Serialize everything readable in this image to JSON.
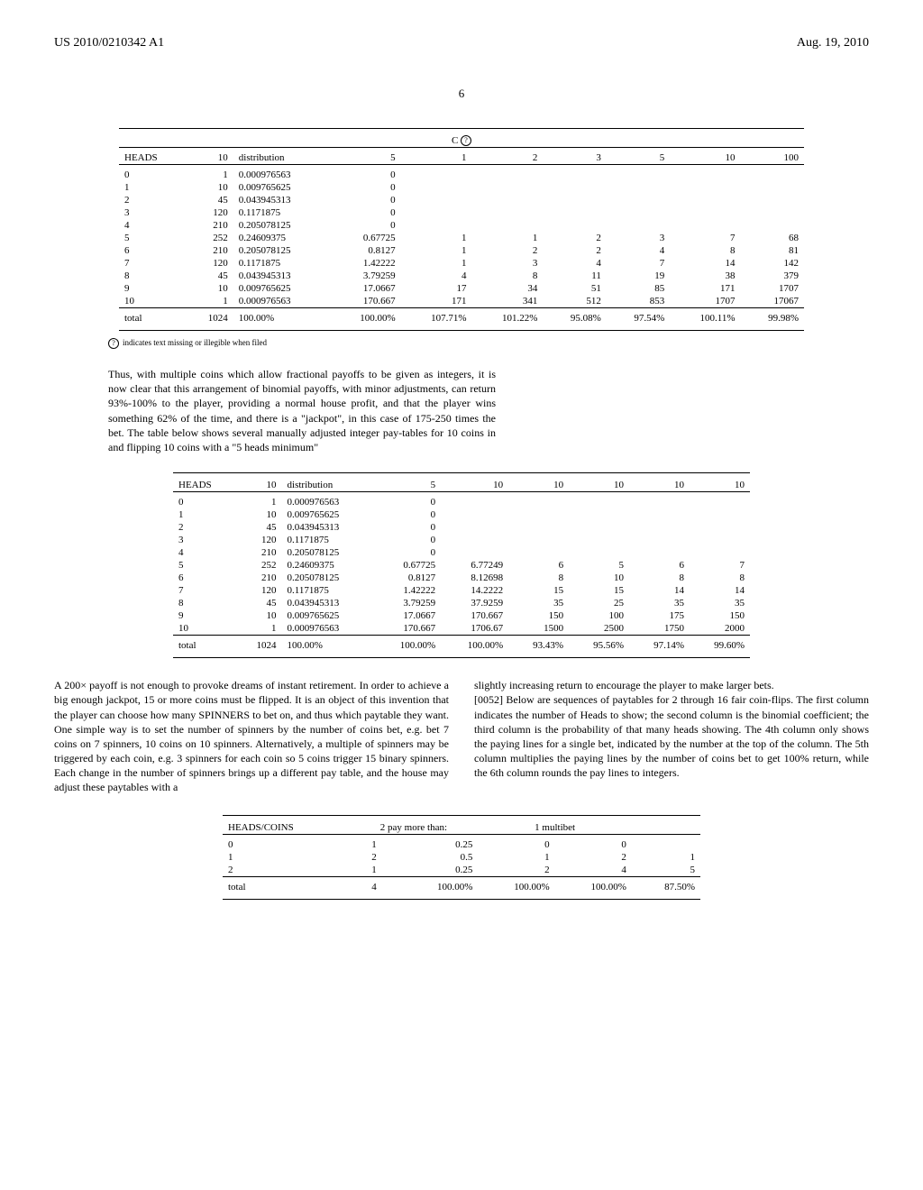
{
  "header": {
    "pub_number": "US 2010/0210342 A1",
    "pub_date": "Aug. 19, 2010"
  },
  "page_number": "6",
  "table1": {
    "title_prefix": "C",
    "title_symbol": "?",
    "headers": [
      "HEADS",
      "10",
      "distribution",
      "5",
      "1",
      "2",
      "3",
      "5",
      "10",
      "100"
    ],
    "rows": [
      [
        "0",
        "1",
        "0.000976563",
        "0",
        "",
        "",
        "",
        "",
        "",
        ""
      ],
      [
        "1",
        "10",
        "0.009765625",
        "0",
        "",
        "",
        "",
        "",
        "",
        ""
      ],
      [
        "2",
        "45",
        "0.043945313",
        "0",
        "",
        "",
        "",
        "",
        "",
        ""
      ],
      [
        "3",
        "120",
        "0.1171875",
        "0",
        "",
        "",
        "",
        "",
        "",
        ""
      ],
      [
        "4",
        "210",
        "0.205078125",
        "0",
        "",
        "",
        "",
        "",
        "",
        ""
      ],
      [
        "5",
        "252",
        "0.24609375",
        "0.67725",
        "1",
        "1",
        "2",
        "3",
        "7",
        "68"
      ],
      [
        "6",
        "210",
        "0.205078125",
        "0.8127",
        "1",
        "2",
        "2",
        "4",
        "8",
        "81"
      ],
      [
        "7",
        "120",
        "0.1171875",
        "1.42222",
        "1",
        "3",
        "4",
        "7",
        "14",
        "142"
      ],
      [
        "8",
        "45",
        "0.043945313",
        "3.79259",
        "4",
        "8",
        "11",
        "19",
        "38",
        "379"
      ],
      [
        "9",
        "10",
        "0.009765625",
        "17.0667",
        "17",
        "34",
        "51",
        "85",
        "171",
        "1707"
      ],
      [
        "10",
        "1",
        "0.000976563",
        "170.667",
        "171",
        "341",
        "512",
        "853",
        "1707",
        "17067"
      ]
    ],
    "total_row": [
      "total",
      "1024",
      "100.00%",
      "100.00%",
      "107.71%",
      "101.22%",
      "95.08%",
      "97.54%",
      "100.11%",
      "99.98%"
    ],
    "footnote": "indicates text missing or illegible when filed"
  },
  "para1": "Thus, with multiple coins which allow fractional payoffs to be given as integers, it is now clear that this arrangement of binomial payoffs, with minor adjustments, can return 93%-100% to the player, providing a normal house profit, and that the player wins something 62% of the time, and there is a \"jackpot\", in this case of 175-250 times the bet. The table below shows several manually adjusted integer pay-tables for 10 coins in and flipping 10 coins with a \"5 heads minimum\"",
  "table2": {
    "headers": [
      "HEADS",
      "10",
      "distribution",
      "5",
      "10",
      "10",
      "10",
      "10",
      "10"
    ],
    "rows": [
      [
        "0",
        "1",
        "0.000976563",
        "0",
        "",
        "",
        "",
        "",
        ""
      ],
      [
        "1",
        "10",
        "0.009765625",
        "0",
        "",
        "",
        "",
        "",
        ""
      ],
      [
        "2",
        "45",
        "0.043945313",
        "0",
        "",
        "",
        "",
        "",
        ""
      ],
      [
        "3",
        "120",
        "0.1171875",
        "0",
        "",
        "",
        "",
        "",
        ""
      ],
      [
        "4",
        "210",
        "0.205078125",
        "0",
        "",
        "",
        "",
        "",
        ""
      ],
      [
        "5",
        "252",
        "0.24609375",
        "0.67725",
        "6.77249",
        "6",
        "5",
        "6",
        "7"
      ],
      [
        "6",
        "210",
        "0.205078125",
        "0.8127",
        "8.12698",
        "8",
        "10",
        "8",
        "8"
      ],
      [
        "7",
        "120",
        "0.1171875",
        "1.42222",
        "14.2222",
        "15",
        "15",
        "14",
        "14"
      ],
      [
        "8",
        "45",
        "0.043945313",
        "3.79259",
        "37.9259",
        "35",
        "25",
        "35",
        "35"
      ],
      [
        "9",
        "10",
        "0.009765625",
        "17.0667",
        "170.667",
        "150",
        "100",
        "175",
        "150"
      ],
      [
        "10",
        "1",
        "0.000976563",
        "170.667",
        "1706.67",
        "1500",
        "2500",
        "1750",
        "2000"
      ]
    ],
    "total_row": [
      "total",
      "1024",
      "100.00%",
      "100.00%",
      "100.00%",
      "93.43%",
      "95.56%",
      "97.14%",
      "99.60%"
    ]
  },
  "col_left": "A 200× payoff is not enough to provoke dreams of instant retirement. In order to achieve a big enough jackpot, 15 or more coins must be flipped. It is an object of this invention that the player can choose how many SPINNERS to bet on, and thus which paytable they want. One simple way is to set the number of spinners by the number of coins bet, e.g. bet 7 coins on 7 spinners, 10 coins on 10 spinners. Alternatively, a multiple of spinners may be triggered by each coin, e.g. 3 spinners for each coin so 5 coins trigger 15 binary spinners. Each change in the number of spinners brings up a different pay table, and the house may adjust these paytables with a",
  "col_right_top": "slightly increasing return to encourage the player to make larger bets.",
  "col_right_para": "[0052]   Below are sequences of paytables for 2 through 16 fair coin-flips. The first column indicates the number of Heads to show; the second column is the binomial coefficient; the third column is the probability of that many heads showing. The 4th column only shows the paying lines for a single bet, indicated by the number at the top of the column. The 5th column multiplies the paying lines by the number of coins bet to get 100% return, while the 6th column rounds the pay lines to integers.",
  "table3": {
    "headers": [
      "HEADS/COINS",
      "2 pay more than:",
      "",
      "1 multibet",
      "",
      ""
    ],
    "rows": [
      [
        "0",
        "1",
        "0.25",
        "0",
        "0",
        ""
      ],
      [
        "1",
        "2",
        "0.5",
        "1",
        "2",
        "1"
      ],
      [
        "2",
        "1",
        "0.25",
        "2",
        "4",
        "5"
      ]
    ],
    "total_row": [
      "total",
      "4",
      "100.00%",
      "100.00%",
      "100.00%",
      "87.50%"
    ]
  }
}
